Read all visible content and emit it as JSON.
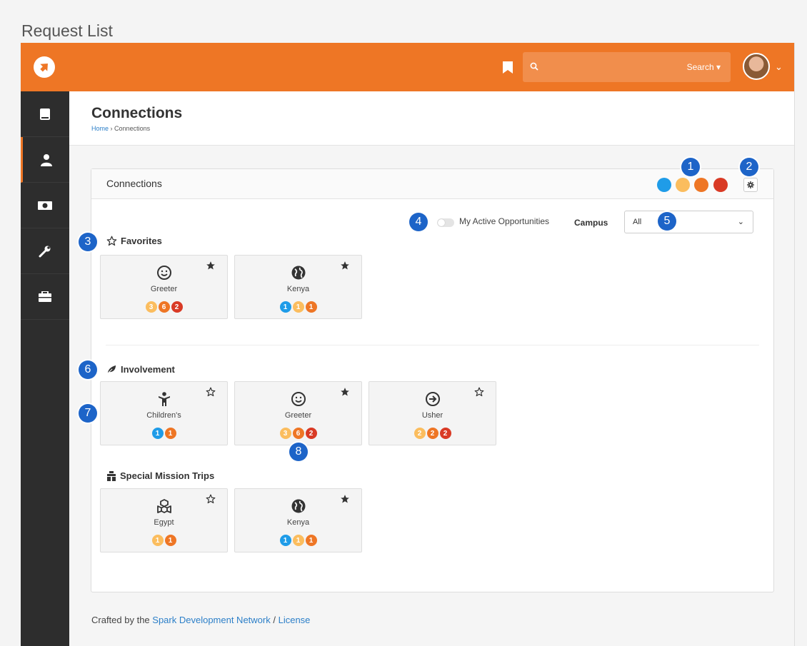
{
  "doc_title": "Request List",
  "header": {
    "search_label": "Search ▾",
    "avatar_caret": "⌄"
  },
  "page": {
    "title": "Connections",
    "breadcrumb": {
      "home": "Home",
      "separator": "›",
      "current": "Connections"
    }
  },
  "panel": {
    "title": "Connections",
    "status_colors": [
      "#1f9ce8",
      "#fbbd5e",
      "#ee7625",
      "#d93a25"
    ]
  },
  "filters": {
    "toggle_label": "My Active Opportunities",
    "campus_label": "Campus",
    "campus_value": "All",
    "campus_chevron": "⌄"
  },
  "sections": [
    {
      "label": "Favorites",
      "cards": [
        {
          "name": "Greeter",
          "icon": "smile-icon",
          "favorite": true,
          "badges": [
            {
              "n": "3",
              "c": "#fbbd5e"
            },
            {
              "n": "6",
              "c": "#ee7625"
            },
            {
              "n": "2",
              "c": "#d93a25"
            }
          ]
        },
        {
          "name": "Kenya",
          "icon": "globe-icon",
          "favorite": true,
          "badges": [
            {
              "n": "1",
              "c": "#1f9ce8"
            },
            {
              "n": "1",
              "c": "#fbbd5e"
            },
            {
              "n": "1",
              "c": "#ee7625"
            }
          ]
        }
      ]
    },
    {
      "label": "Involvement",
      "cards": [
        {
          "name": "Children's",
          "icon": "child-icon",
          "favorite": false,
          "badges": [
            {
              "n": "1",
              "c": "#1f9ce8"
            },
            {
              "n": "1",
              "c": "#ee7625"
            }
          ]
        },
        {
          "name": "Greeter",
          "icon": "smile-icon",
          "favorite": true,
          "badges": [
            {
              "n": "3",
              "c": "#fbbd5e"
            },
            {
              "n": "6",
              "c": "#ee7625"
            },
            {
              "n": "2",
              "c": "#d93a25"
            }
          ]
        },
        {
          "name": "Usher",
          "icon": "arrow-right-circle-icon",
          "favorite": false,
          "badges": [
            {
              "n": "2",
              "c": "#fbbd5e"
            },
            {
              "n": "2",
              "c": "#ee7625"
            },
            {
              "n": "2",
              "c": "#d93a25"
            }
          ]
        }
      ]
    },
    {
      "label": "Special Mission Trips",
      "cards": [
        {
          "name": "Egypt",
          "icon": "cubes-icon",
          "favorite": false,
          "badges": [
            {
              "n": "1",
              "c": "#fbbd5e"
            },
            {
              "n": "1",
              "c": "#ee7625"
            }
          ]
        },
        {
          "name": "Kenya",
          "icon": "globe-icon",
          "favorite": true,
          "badges": [
            {
              "n": "1",
              "c": "#1f9ce8"
            },
            {
              "n": "1",
              "c": "#fbbd5e"
            },
            {
              "n": "1",
              "c": "#ee7625"
            }
          ]
        }
      ]
    }
  ],
  "footer": {
    "prefix": "Crafted by the ",
    "link1": "Spark Development Network",
    "sep": " / ",
    "link2": "License"
  },
  "callouts": [
    "1",
    "2",
    "3",
    "4",
    "5",
    "6",
    "7",
    "8"
  ]
}
